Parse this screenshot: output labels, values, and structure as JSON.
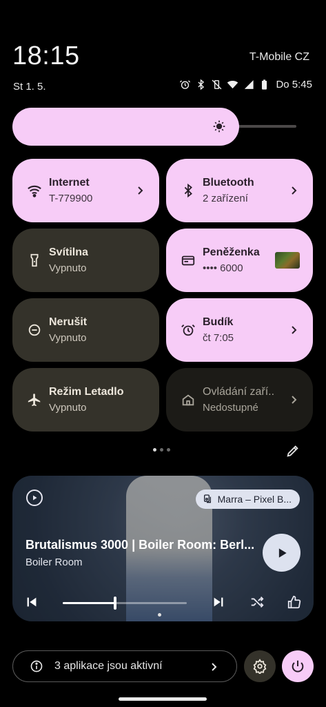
{
  "header": {
    "time": "18:15",
    "carrier": "T-Mobile CZ",
    "date": "St 1. 5.",
    "battery_text": "Do 5:45"
  },
  "status_icons": [
    "alarm-icon",
    "bluetooth-icon",
    "vibrate-off-icon",
    "wifi-icon",
    "signal-icon",
    "battery-icon"
  ],
  "brightness": {
    "level": 0.73,
    "icon": "brightness-icon"
  },
  "tiles": [
    {
      "title": "Internet",
      "subtitle": "T-779900",
      "state": "on",
      "icon": "wifi-icon",
      "chevron": true
    },
    {
      "title": "Bluetooth",
      "subtitle": "2 zařízení",
      "state": "on",
      "icon": "bluetooth-icon",
      "chevron": true
    },
    {
      "title": "Svítilna",
      "subtitle": "Vypnuto",
      "state": "off",
      "icon": "flashlight-icon"
    },
    {
      "title": "Peněženka",
      "subtitle": "•••• 6000",
      "state": "on",
      "icon": "wallet-icon"
    },
    {
      "title": "Nerušit",
      "subtitle": "Vypnuto",
      "state": "off",
      "icon": "do-not-disturb-icon"
    },
    {
      "title": "Budík",
      "subtitle": "čt 7:05",
      "state": "on",
      "icon": "alarm-icon",
      "chevron": true
    },
    {
      "title": "Režim Letadlo",
      "subtitle": "Vypnuto",
      "state": "off",
      "icon": "airplane-icon"
    },
    {
      "title": "Ovládání zaří..",
      "subtitle": "Nedostupné",
      "state": "unavailable",
      "icon": "home-icon",
      "chevron": true
    }
  ],
  "pager": {
    "pages": 3,
    "active": 0
  },
  "media": {
    "title": "Brutalismus 3000 | Boiler Room: Berl...",
    "artist": "Boiler Room",
    "output_device": "Marra – Pixel B...",
    "progress": 0.42
  },
  "footer": {
    "active_apps_text": "3 aplikace jsou aktivní"
  },
  "colors": {
    "accent": "#f7ccf7",
    "tile_off": "#34322a",
    "background": "#000000"
  }
}
